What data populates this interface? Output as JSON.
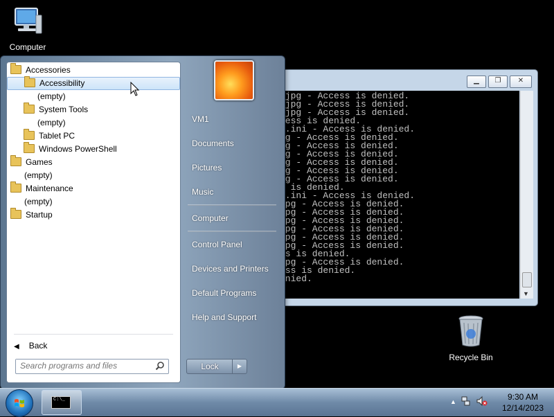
{
  "desktop": {
    "computer_label": "Computer",
    "recycle_label": "Recycle Bin"
  },
  "console": {
    "lines": [
      ".jpg - Access is denied.",
      ".jpg - Access is denied.",
      ".jpg - Access is denied.",
      "cess is denied.",
      "p.ini - Access is denied.",
      "pg - Access is denied.",
      "pg - Access is denied.",
      "pg - Access is denied.",
      "pg - Access is denied.",
      "pg - Access is denied.",
      "pg - Access is denied.",
      "s is denied.",
      "p.ini - Access is denied.",
      "jpg - Access is denied.",
      "jpg - Access is denied.",
      "jpg - Access is denied.",
      "jpg - Access is denied.",
      "jpg - Access is denied.",
      "jpg - Access is denied.",
      "ss is denied.",
      "jpg - Access is denied.",
      "ess is denied.",
      "enied."
    ]
  },
  "start_menu": {
    "tree": [
      {
        "label": "Accessories",
        "indent": 0,
        "folder": true,
        "selected": false
      },
      {
        "label": "Accessibility",
        "indent": 1,
        "folder": true,
        "selected": true
      },
      {
        "label": "(empty)",
        "indent": 2,
        "folder": false,
        "selected": false
      },
      {
        "label": "System Tools",
        "indent": 1,
        "folder": true,
        "selected": false
      },
      {
        "label": "(empty)",
        "indent": 2,
        "folder": false,
        "selected": false
      },
      {
        "label": "Tablet PC",
        "indent": 1,
        "folder": true,
        "selected": false
      },
      {
        "label": "Windows PowerShell",
        "indent": 1,
        "folder": true,
        "selected": false
      },
      {
        "label": "Games",
        "indent": 0,
        "folder": true,
        "selected": false
      },
      {
        "label": "(empty)",
        "indent": 1,
        "folder": false,
        "selected": false
      },
      {
        "label": "Maintenance",
        "indent": 0,
        "folder": true,
        "selected": false
      },
      {
        "label": "(empty)",
        "indent": 1,
        "folder": false,
        "selected": false
      },
      {
        "label": "Startup",
        "indent": 0,
        "folder": true,
        "selected": false
      }
    ],
    "back_label": "Back",
    "search_placeholder": "Search programs and files",
    "right": {
      "user": "VM1",
      "documents": "Documents",
      "pictures": "Pictures",
      "music": "Music",
      "computer": "Computer",
      "control_panel": "Control Panel",
      "devices": "Devices and Printers",
      "default_programs": "Default Programs",
      "help": "Help and Support"
    },
    "lock_label": "Lock"
  },
  "taskbar": {
    "time": "9:30 AM",
    "date": "12/14/2023"
  }
}
